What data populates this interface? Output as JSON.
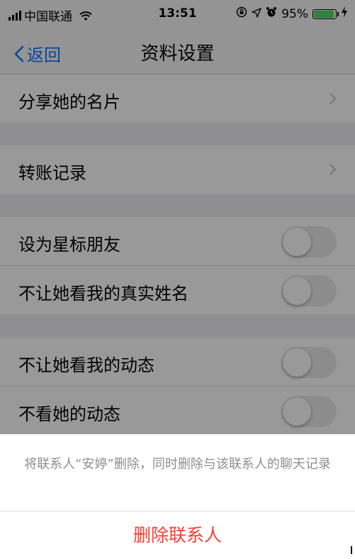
{
  "status_bar": {
    "carrier": "中国联通",
    "time": "13:51",
    "battery_percent": "95%",
    "battery_level": 0.95,
    "icons": [
      "signal-icon",
      "wifi-icon",
      "orientation-lock-icon",
      "location-icon",
      "alarm-icon",
      "battery-icon",
      "charging-icon"
    ]
  },
  "nav": {
    "back_label": "返回",
    "title": "资料设置"
  },
  "groups": [
    {
      "rows": [
        {
          "label": "分享她的名片",
          "accessory": "chevron"
        }
      ]
    },
    {
      "rows": [
        {
          "label": "转账记录",
          "accessory": "chevron"
        }
      ]
    },
    {
      "rows": [
        {
          "label": "设为星标朋友",
          "accessory": "switch",
          "on": false
        },
        {
          "label": "不让她看我的真实姓名",
          "accessory": "switch",
          "on": false
        }
      ]
    },
    {
      "rows": [
        {
          "label": "不让她看我的动态",
          "accessory": "switch",
          "on": false
        },
        {
          "label": "不看她的动态",
          "accessory": "switch",
          "on": false
        }
      ]
    }
  ],
  "action_sheet": {
    "message": "将联系人“安婷”删除，同时删除与该联系人的聊天记录",
    "delete_label": "删除联系人"
  },
  "colors": {
    "accent": "#0a7aff",
    "destructive": "#fe3b30",
    "battery_green": "#4cd964",
    "message_gray": "#8e8e93"
  }
}
